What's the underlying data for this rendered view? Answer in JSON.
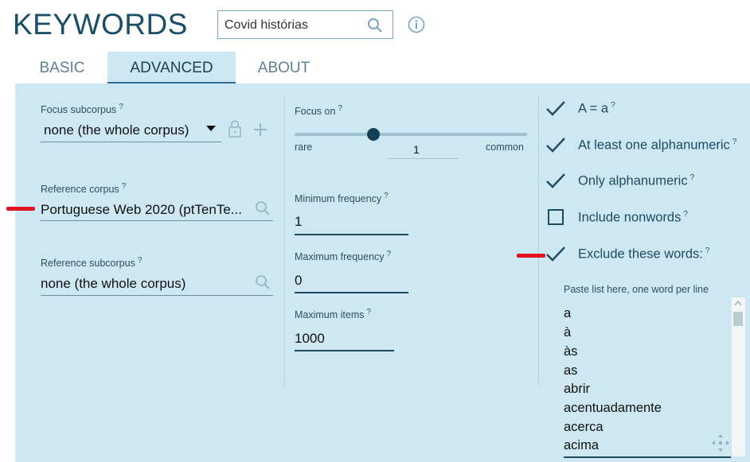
{
  "app_title": "KEYWORDS",
  "search": {
    "value": "Covid histórias"
  },
  "tabs": [
    {
      "label": "BASIC",
      "active": false
    },
    {
      "label": "ADVANCED",
      "active": true
    },
    {
      "label": "ABOUT",
      "active": false
    }
  ],
  "col1": {
    "focus_subcorpus": {
      "label": "Focus subcorpus",
      "help": "?",
      "value": "none (the whole corpus)"
    },
    "reference_corpus": {
      "label": "Reference corpus",
      "help": "?",
      "value": "Portuguese Web 2020 (ptTenTe..."
    },
    "reference_subcorpus": {
      "label": "Reference subcorpus",
      "help": "?",
      "value": "none (the whole corpus)"
    }
  },
  "col2": {
    "focus_on": {
      "label": "Focus on",
      "help": "?",
      "left_label": "rare",
      "right_label": "common",
      "value": "1"
    },
    "min_freq": {
      "label": "Minimum frequency",
      "help": "?",
      "value": "1"
    },
    "max_freq": {
      "label": "Maximum frequency",
      "help": "?",
      "value": "0"
    },
    "max_items": {
      "label": "Maximum items",
      "help": "?",
      "value": "1000"
    }
  },
  "col3": {
    "options": [
      {
        "label": "A = a",
        "help": "?",
        "checked": true
      },
      {
        "label": "At least one alphanumeric",
        "help": "?",
        "checked": true
      },
      {
        "label": "Only alphanumeric",
        "help": "?",
        "checked": true
      },
      {
        "label": "Include nonwords",
        "help": "?",
        "checked": false
      },
      {
        "label": "Exclude these words:",
        "help": "?",
        "checked": true
      }
    ],
    "paste_label": "Paste list here, one word per line",
    "words": [
      "a",
      "à",
      "às",
      "as",
      "abrir",
      "acentuadamente",
      "acerca",
      "acima"
    ]
  },
  "colors": {
    "accent": "#1f4a60",
    "panel_bg": "#cde8f2",
    "mark_red": "#e0141e"
  }
}
